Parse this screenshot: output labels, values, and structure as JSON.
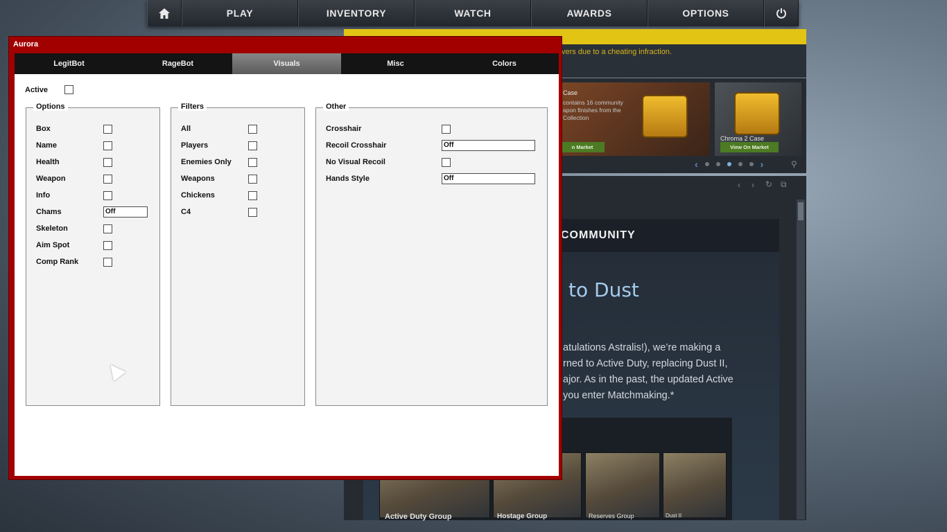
{
  "game": {
    "nav": [
      "PLAY",
      "INVENTORY",
      "WATCH",
      "AWARDS",
      "OPTIONS"
    ],
    "news_text": "vers due to a cheating infraction.",
    "store": {
      "tile1_title": "Case",
      "tile1_desc": [
        "contains 16 community",
        "apon finishes from the",
        "Collection"
      ],
      "tile1_button": "n Market",
      "tile2_title": "Chroma 2 Case",
      "tile2_button": "View On Market"
    },
    "blog": {
      "community": "COMMUNITY",
      "title": "to Dust",
      "lines": [
        "atulations Astralis!), we’re making a",
        "rned to Active Duty, replacing Dust II,",
        "ajor. As in the past, the updated Active",
        "you enter Matchmaking.*"
      ],
      "thumbs": [
        "Active Duty Group",
        "Hostage Group",
        "Reserves Group",
        "Dust II"
      ]
    }
  },
  "aurora": {
    "title": "Aurora",
    "tabs": [
      "LegitBot",
      "RageBot",
      "Visuals",
      "Misc",
      "Colors"
    ],
    "active_tab": "Visuals",
    "active_label": "Active",
    "groups": {
      "options": {
        "title": "Options",
        "items": [
          "Box",
          "Name",
          "Health",
          "Weapon",
          "Info",
          "Chams",
          "Skeleton",
          "Aim Spot",
          "Comp Rank"
        ],
        "chams_value": "Off"
      },
      "filters": {
        "title": "Filters",
        "items": [
          "All",
          "Players",
          "Enemies Only",
          "Weapons",
          "Chickens",
          "C4"
        ]
      },
      "other": {
        "title": "Other",
        "items": [
          "Crosshair",
          "Recoil Crosshair",
          "No Visual Recoil",
          "Hands Style"
        ],
        "recoil_crosshair_value": "Off",
        "hands_style_value": "Off"
      }
    }
  }
}
